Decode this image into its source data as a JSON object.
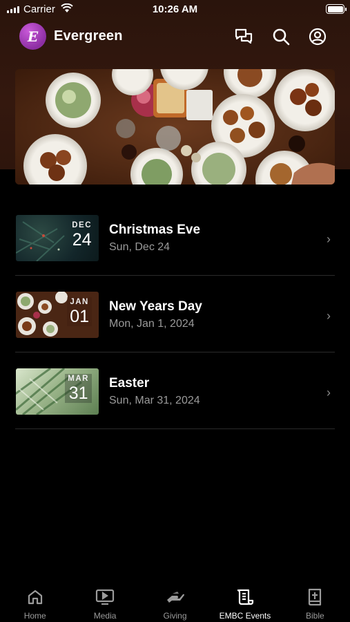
{
  "status_bar": {
    "carrier": "Carrier",
    "time": "10:26 AM"
  },
  "header": {
    "app_name": "Evergreen",
    "logo_letter": "E"
  },
  "events": [
    {
      "month": "DEC",
      "day": "24",
      "title": "Christmas Eve",
      "date": "Sun, Dec 24"
    },
    {
      "month": "JAN",
      "day": "01",
      "title": "New Years Day",
      "date": "Mon, Jan 1, 2024"
    },
    {
      "month": "MAR",
      "day": "31",
      "title": "Easter",
      "date": "Sun, Mar 31, 2024"
    }
  ],
  "tabs": [
    {
      "label": "Home",
      "icon": "home-icon"
    },
    {
      "label": "Media",
      "icon": "media-icon"
    },
    {
      "label": "Giving",
      "icon": "giving-icon"
    },
    {
      "label": "EMBC Events",
      "icon": "events-icon",
      "active": true
    },
    {
      "label": "Bible",
      "icon": "bible-icon"
    }
  ],
  "colors": {
    "background": "#000000",
    "header_bg": "#2f160d",
    "accent_logo": "#a23cbc",
    "muted_text": "#9a9a9a"
  }
}
